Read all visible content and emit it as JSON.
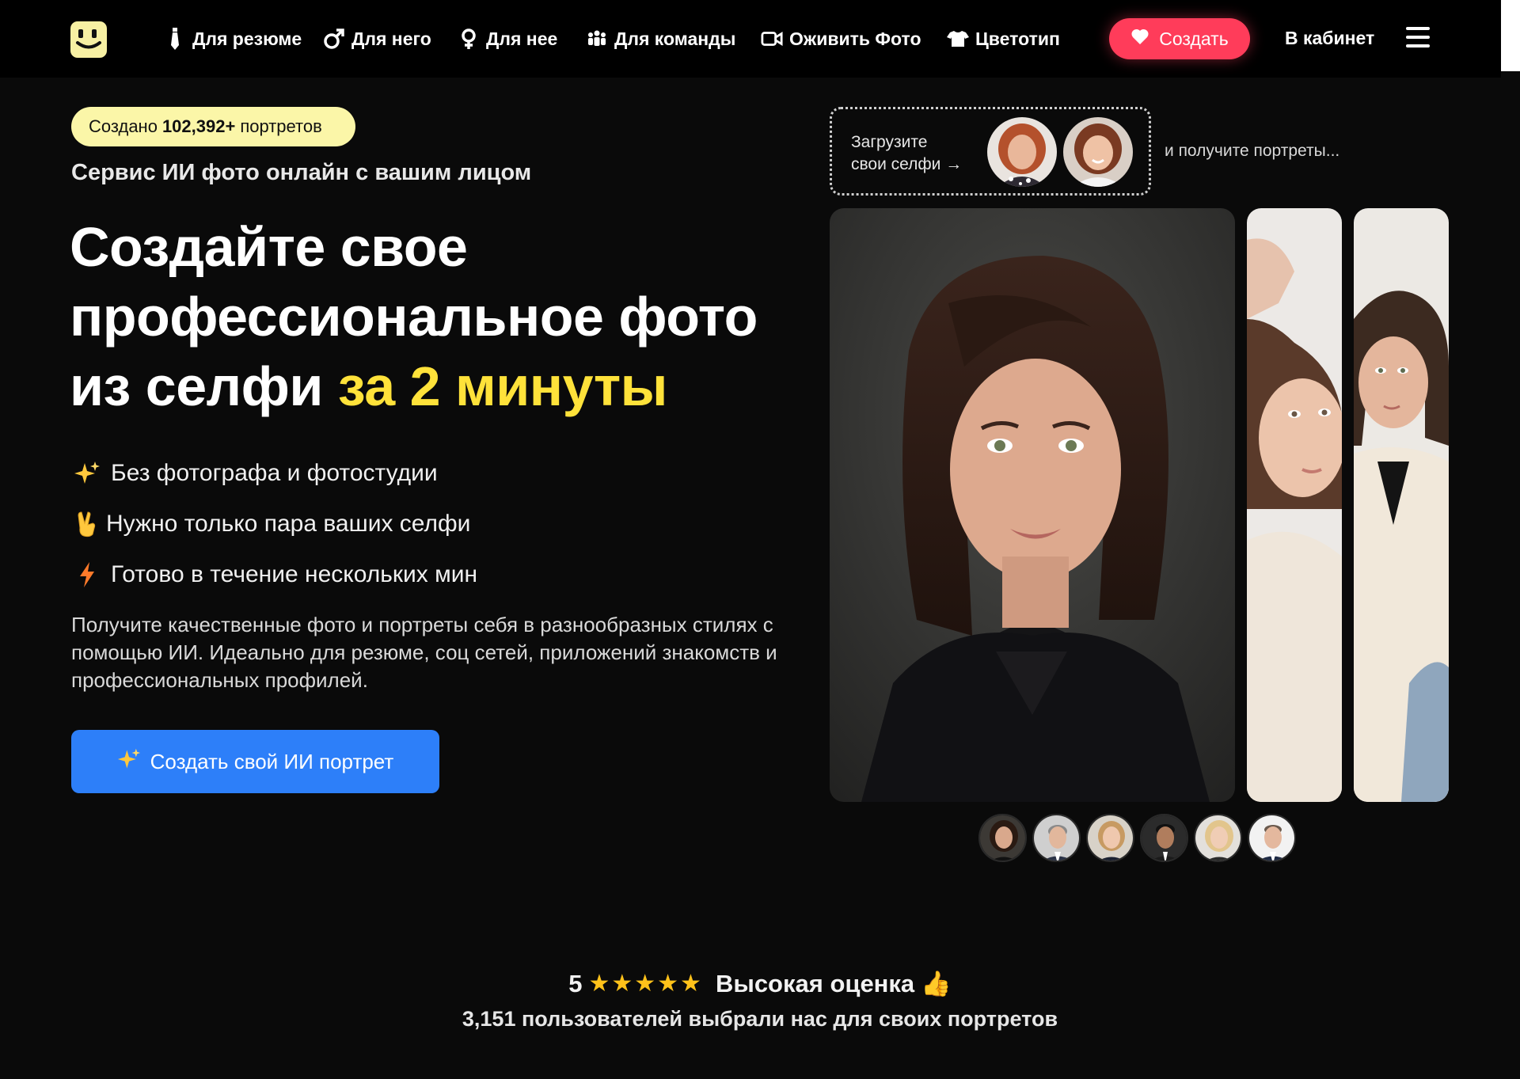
{
  "nav": {
    "items": [
      {
        "label": "Для резюме",
        "icon": "tie-icon"
      },
      {
        "label": "Для него",
        "icon": "male-icon"
      },
      {
        "label": "Для нее",
        "icon": "female-icon"
      },
      {
        "label": "Для команды",
        "icon": "team-icon"
      },
      {
        "label": "Оживить Фото",
        "icon": "video-camera-icon"
      },
      {
        "label": "Цветотип",
        "icon": "tshirt-icon"
      }
    ],
    "create_label": "Создать",
    "cabinet_label": "В кабинет"
  },
  "hero": {
    "badge_prefix": "Создано",
    "badge_count": "102,392+",
    "badge_suffix": "портретов",
    "subtitle": "Сервис ИИ фото онлайн с вашим лицом",
    "headline_line1": "Создайте свое",
    "headline_line2": "профессиональное фото",
    "headline_line3_plain": "из селфи",
    "headline_line3_highlight": "за 2 минуты",
    "features": [
      {
        "emoji": "✨",
        "text": "Без фотографа и фотостудии"
      },
      {
        "emoji": "✌",
        "text": "Нужно только пара ваших селфи"
      },
      {
        "emoji": "⚡",
        "text": "Готово в течение нескольких мин"
      }
    ],
    "description": "Получите качественные фото и портреты себя в разнообразных стилях с помощью ИИ. Идеально для резюме, соц сетей, приложений знакомств и профессиональных профилей.",
    "cta_label": "Создать свой ИИ портрет"
  },
  "upload": {
    "line1": "Загрузите",
    "line2": "свои селфи →",
    "after": "и получите портреты..."
  },
  "rating": {
    "score": "5",
    "stars": "★★★★★",
    "label": "Высокая оценка",
    "emoji": "👍",
    "subtext": "3,151 пользователей выбрали нас для своих портретов"
  },
  "colors": {
    "accent_yellow": "#ffe23a",
    "badge_bg": "#fbf6a8",
    "create_red": "#ff3c5a",
    "cta_blue": "#2d7ff9"
  }
}
